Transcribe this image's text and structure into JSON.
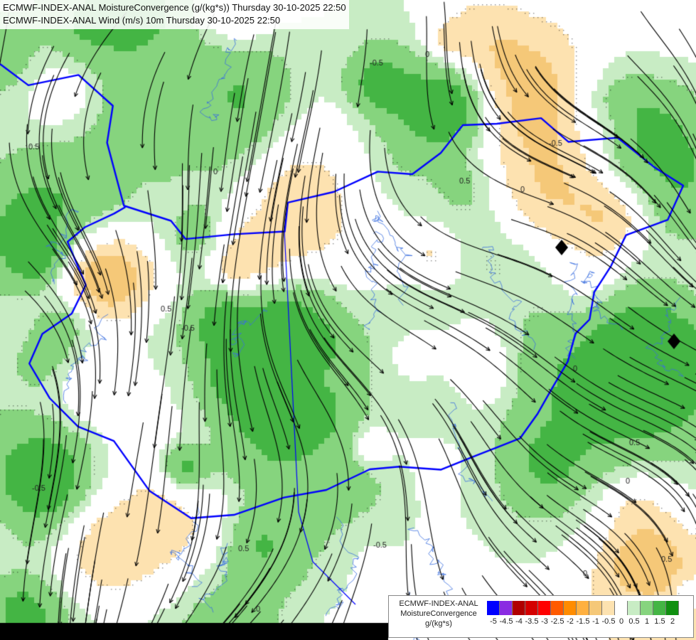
{
  "title": {
    "line1": "ECMWF-INDEX-ANAL MoistureConvergence (g/(kg*s)) Thursday 30-10-2025 22:50",
    "line2": "ECMWF-INDEX-ANAL Wind (m/s) 10m Thursday 30-10-2025 22:50"
  },
  "legend": {
    "label_line1": "ECMWF-INDEX-ANAL",
    "label_line2": "MoistureConvergence",
    "label_line3": "g/(kg*s)",
    "tick_labels": [
      "-5",
      "-4.5",
      "-4",
      "-3.5",
      "-3",
      "-2.5",
      "-2",
      "-1.5",
      "-1",
      "-0.5",
      "0",
      "0.5",
      "1",
      "1.5",
      "2"
    ],
    "colors": [
      "#0000ff",
      "#8a2be2",
      "#b00000",
      "#d40000",
      "#ff0000",
      "#ff5a00",
      "#ff8c00",
      "#ffb040",
      "#f5c878",
      "#fde2b0",
      "#ffffff",
      "#c8ecc4",
      "#86d47e",
      "#44b544",
      "#109010"
    ]
  },
  "contour_labels": [
    "0",
    "-0.5",
    "0.5",
    "0",
    "0.5",
    "-0.5",
    "0",
    "0.5",
    "-0.5",
    "0",
    "0.5",
    "0",
    "-0.5",
    "0.5",
    "0",
    "0.5",
    "-0.5",
    "0"
  ],
  "map_colors": {
    "border": "#0000ff",
    "river": "#3a6fe0",
    "streamline": "#000000",
    "negative_fill": "#f5c878",
    "positive_fill": "#86d47e",
    "strong_positive_fill": "#44b544"
  },
  "icons": [
    "streamline-arrow-icon"
  ]
}
